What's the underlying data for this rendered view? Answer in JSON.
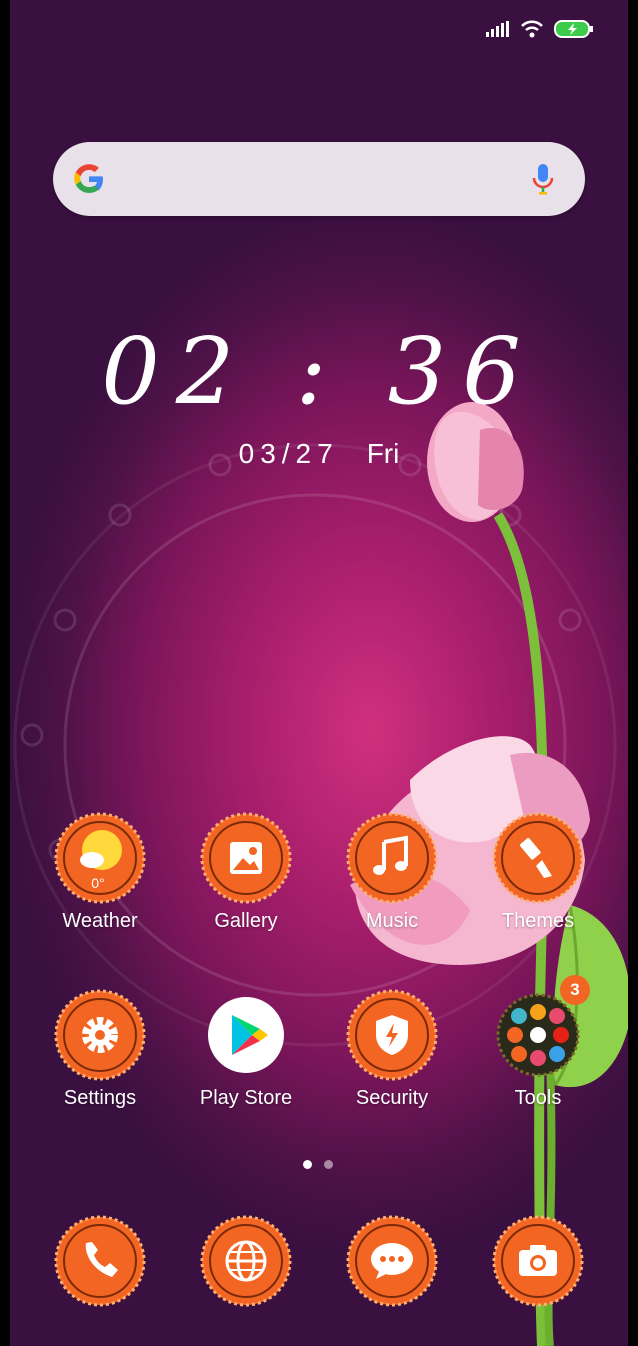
{
  "status": {
    "signal": "signal-icon",
    "wifi": "wifi-icon",
    "battery": "battery-charging-icon"
  },
  "search": {
    "logo": "google-g-icon",
    "mic": "mic-icon"
  },
  "clock": {
    "time": "02 : 36",
    "date": "03/27",
    "day": "Fri"
  },
  "apps_row1": [
    {
      "label": "Weather",
      "icon": "weather-icon",
      "temp": "0°"
    },
    {
      "label": "Gallery",
      "icon": "gallery-icon"
    },
    {
      "label": "Music",
      "icon": "music-icon"
    },
    {
      "label": "Themes",
      "icon": "themes-icon"
    }
  ],
  "apps_row2": [
    {
      "label": "Settings",
      "icon": "settings-icon"
    },
    {
      "label": "Play Store",
      "icon": "play-store-icon"
    },
    {
      "label": "Security",
      "icon": "security-icon"
    },
    {
      "label": "Tools",
      "icon": "tools-folder-icon",
      "badge": "3"
    }
  ],
  "page_indicator": {
    "pages": 2,
    "current": 1
  },
  "dock": [
    {
      "icon": "phone-icon"
    },
    {
      "icon": "browser-icon"
    },
    {
      "icon": "messages-icon"
    },
    {
      "icon": "camera-icon"
    }
  ],
  "colors": {
    "accent": "#f26522",
    "badge": "#f26522",
    "bg": "#a81e6c"
  }
}
